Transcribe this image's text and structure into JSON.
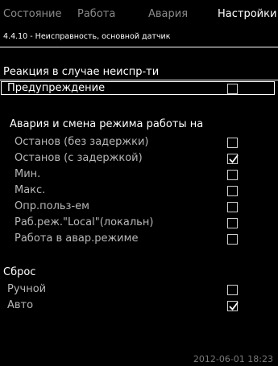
{
  "tabs": [
    "Состояние",
    "Работа",
    "Авария",
    "Настройки"
  ],
  "active_tab": "Настройки",
  "subtitle": "4.4.10 - Неисправность, основной датчик",
  "reaction": {
    "heading": "Реакция в случае неиспр-ти",
    "options": [
      {
        "label": "Предупреждение",
        "checked": false
      }
    ]
  },
  "alarm": {
    "heading": "Авария и смена режима работы на",
    "options": [
      {
        "label": "Останов (без задержки)",
        "checked": false
      },
      {
        "label": "Останов (с задержкой)",
        "checked": true
      },
      {
        "label": "Мин.",
        "checked": false
      },
      {
        "label": "Макс.",
        "checked": false
      },
      {
        "label": "Опр.польз-ем",
        "checked": false
      },
      {
        "label": "Раб.реж.\"Local\"(локальн)",
        "checked": false
      },
      {
        "label": "Работа в авар.режиме",
        "checked": false
      }
    ]
  },
  "reset": {
    "heading": "Сброс",
    "options": [
      {
        "label": "Ручной",
        "checked": false
      },
      {
        "label": "Авто",
        "checked": true
      }
    ]
  },
  "footer_datetime": "2012-06-01 18:23"
}
